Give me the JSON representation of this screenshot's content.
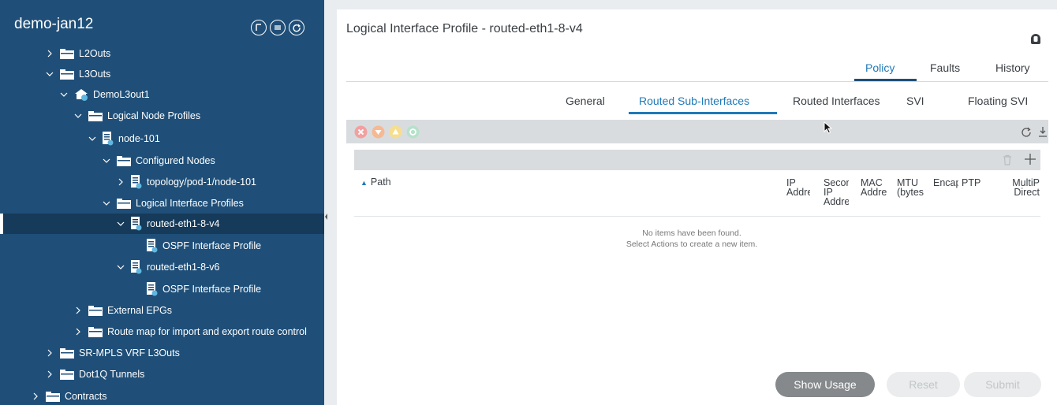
{
  "sidebar": {
    "title": "demo-jan12",
    "items": [
      {
        "label": "L2Outs",
        "icon": "folder-icon",
        "expanded": false
      },
      {
        "label": "L3Outs",
        "icon": "folder-icon",
        "expanded": true
      },
      {
        "label": "DemoL3out1",
        "icon": "l3out-icon",
        "expanded": true
      },
      {
        "label": "Logical Node Profiles",
        "icon": "folder-icon",
        "expanded": true
      },
      {
        "label": "node-101",
        "icon": "node-profile-icon",
        "expanded": true
      },
      {
        "label": "Configured Nodes",
        "icon": "folder-icon",
        "expanded": true
      },
      {
        "label": "topology/pod-1/node-101",
        "icon": "node-profile-icon",
        "expanded": false
      },
      {
        "label": "Logical Interface Profiles",
        "icon": "folder-icon",
        "expanded": true
      },
      {
        "label": "routed-eth1-8-v4",
        "icon": "node-profile-icon",
        "expanded": true,
        "selected": true
      },
      {
        "label": "OSPF Interface Profile",
        "icon": "node-profile-icon"
      },
      {
        "label": "routed-eth1-8-v6",
        "icon": "node-profile-icon",
        "expanded": true
      },
      {
        "label": "OSPF Interface Profile",
        "icon": "node-profile-icon"
      },
      {
        "label": "External EPGs",
        "icon": "folder-icon",
        "expanded": false
      },
      {
        "label": "Route map for import and export route control",
        "icon": "folder-icon",
        "expanded": false
      },
      {
        "label": "SR-MPLS VRF L3Outs",
        "icon": "folder-icon",
        "expanded": false
      },
      {
        "label": "Dot1Q Tunnels",
        "icon": "folder-icon",
        "expanded": false
      },
      {
        "label": "Contracts",
        "icon": "folder-icon",
        "expanded": false
      }
    ]
  },
  "main": {
    "title": "Logical Interface Profile - routed-eth1-8-v4",
    "top_tabs": [
      "Policy",
      "Faults",
      "History"
    ],
    "sub_tabs": [
      "General",
      "Routed Sub-Interfaces",
      "Routed Interfaces",
      "SVI",
      "Floating SVI"
    ],
    "columns": [
      "Path",
      "IP Addre",
      "Secor IP Addre",
      "MAC Addre",
      "MTU (bytes",
      "Encap",
      "PTP",
      "MultiP Direct"
    ],
    "empty_message_line1": "No items have been found.",
    "empty_message_line2": "Select Actions to create a new item.",
    "buttons": {
      "show_usage": "Show Usage",
      "reset": "Reset",
      "submit": "Submit"
    }
  },
  "colors": {
    "sidebar_bg": "#1f4f78",
    "sidebar_selected": "#163a59",
    "accent": "#1f79b8",
    "fault_critical": "#f2a0a0",
    "fault_major": "#f5b994",
    "fault_minor": "#f7de8e",
    "fault_warning": "#b6e1cb"
  }
}
